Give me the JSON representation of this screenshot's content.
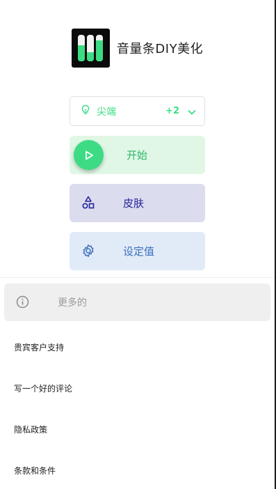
{
  "app": {
    "title": "音量条DIY美化",
    "accent": "#3ddc84"
  },
  "tip": {
    "label": "尖端",
    "count": "+2"
  },
  "actions": {
    "start": "开始",
    "skin": "皮肤",
    "settings": "设定值"
  },
  "more": {
    "label": "更多的"
  },
  "menu": [
    {
      "label": "贵宾客户支持"
    },
    {
      "label": "写一个好的评论"
    },
    {
      "label": "隐私政策"
    },
    {
      "label": "条款和条件"
    }
  ]
}
